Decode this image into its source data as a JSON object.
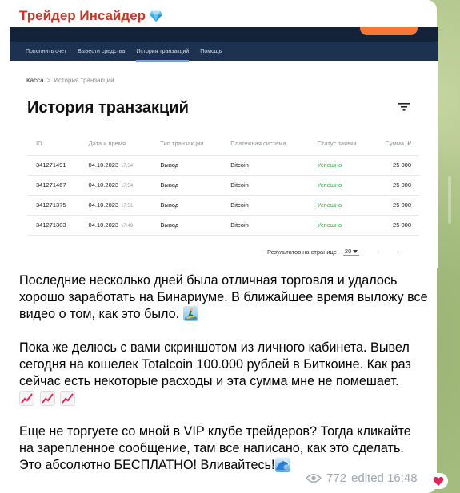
{
  "channel": {
    "sender_name": "Трейдер Инсайдер"
  },
  "screenshot": {
    "nav_items": [
      "Пополнить счет",
      "Вывести средства",
      "История транзакций",
      "Помощь"
    ],
    "breadcrumb": {
      "root": "Касса",
      "current": "История транзакций"
    },
    "title": "История транзакций",
    "columns": [
      "ID",
      "Дата и время",
      "Тип транзакции",
      "Платежная система",
      "Статус заявки",
      "Сумма, ₽"
    ],
    "rows": [
      {
        "id": "341271491",
        "date": "04.10.2023",
        "time": "17:54",
        "type": "Вывод",
        "system": "Bitcoin",
        "status": "Успешно",
        "amount": "25 000"
      },
      {
        "id": "341271467",
        "date": "04.10.2023",
        "time": "17:54",
        "type": "Вывод",
        "system": "Bitcoin",
        "status": "Успешно",
        "amount": "25 000"
      },
      {
        "id": "341271375",
        "date": "04.10.2023",
        "time": "17:51",
        "type": "Вывод",
        "system": "Bitcoin",
        "status": "Успешно",
        "amount": "25 000"
      },
      {
        "id": "341271303",
        "date": "04.10.2023",
        "time": "17:49",
        "type": "Вывод",
        "system": "Bitcoin",
        "status": "Успешно",
        "amount": "25 000"
      }
    ],
    "pager": {
      "label": "Результатов на странице",
      "value": "20"
    }
  },
  "message": {
    "p1": "Последние несколько дней была отличная торговля и удалось хорошо заработать на Бинариуме. В ближайшее время выложу все видео о том, как это было.",
    "p2": "Пока же делюсь с вами скриншотом из личного кабинета. Вывел сегодня на кошелек Totalcoin 100.000 рублей в Биткоине. Как раз сейчас есть некоторые расходы и эта сумма мне не помешает.",
    "p3": "Еще не торгуете со мной в VIP клубе трейдеров? Тогда кликайте на зарепленное сообщение, там все написано, как это сделать. Это абсолютно БЕСПЛАТНО! Вливайтесь!"
  },
  "meta": {
    "views": "772",
    "edited": "edited 16:48"
  },
  "colors": {
    "sender": "#c0392b",
    "success": "#2db84c",
    "nav_bg": "#1d3150",
    "accent": "#f27a38"
  }
}
